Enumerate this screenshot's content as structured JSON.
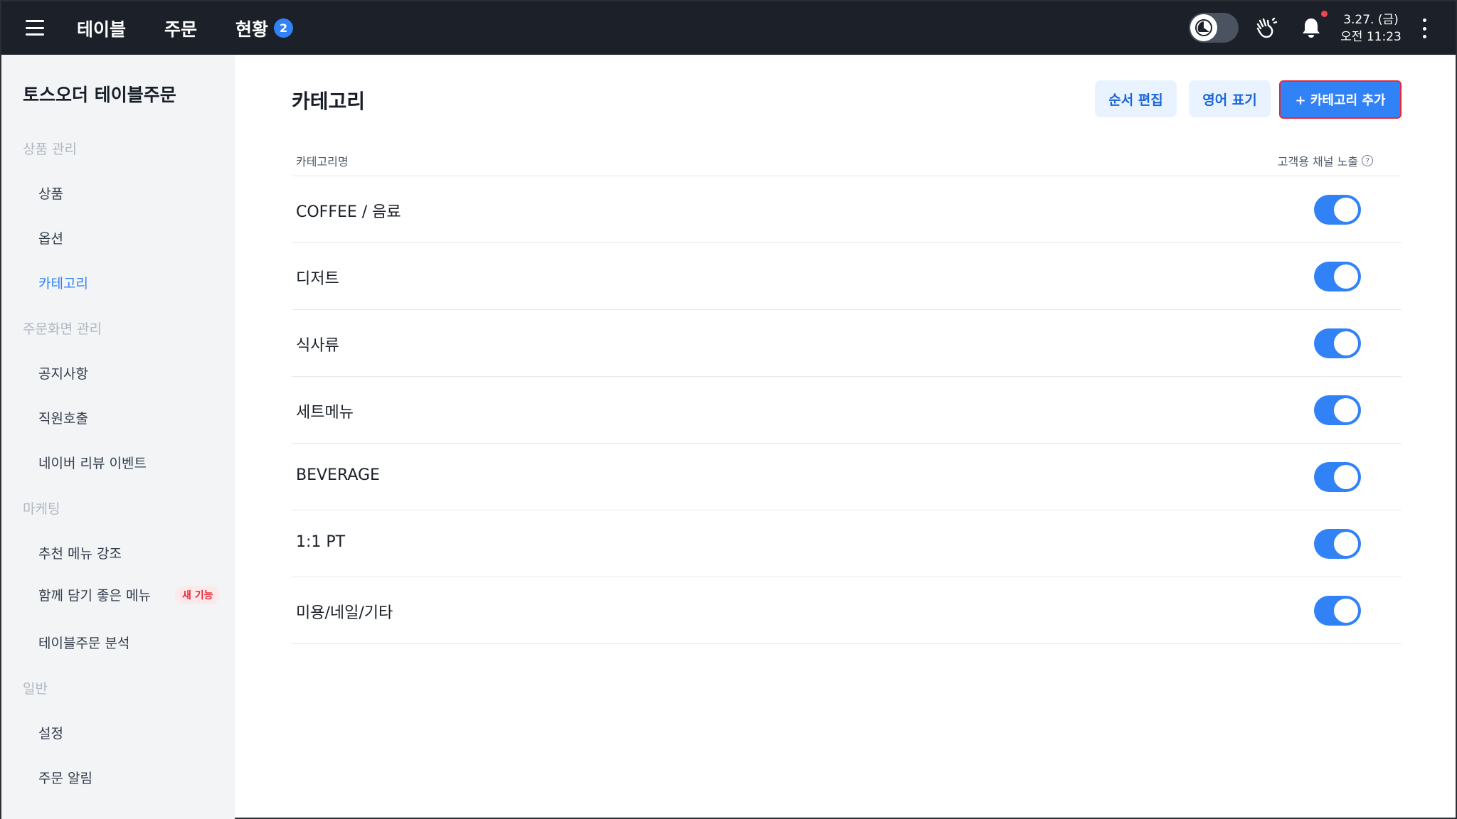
{
  "topbar": {
    "nav": [
      {
        "label": "테이블"
      },
      {
        "label": "주문"
      },
      {
        "label": "현황",
        "badge": "2"
      }
    ],
    "date": "3.27. (금)",
    "time": "오전 11:23"
  },
  "sidebar": {
    "brand": "토스오더 테이블주문",
    "sections": [
      {
        "title": "상품 관리",
        "items": [
          "상품",
          "옵션",
          "카테고리"
        ]
      },
      {
        "title": "주문화면 관리",
        "items": [
          "공지사항",
          "직원호출",
          "네이버 리뷰 이벤트"
        ]
      },
      {
        "title": "마케팅",
        "items": [
          "추천 메뉴 강조",
          "함께 담기 좋은 메뉴",
          "테이블주문 분석"
        ]
      },
      {
        "title": "일반",
        "items": [
          "설정",
          "주문 알림"
        ]
      }
    ],
    "new_badge": "새 기능",
    "active_item": "카테고리"
  },
  "main": {
    "title": "카테고리",
    "buttons": {
      "reorder": "순서 편집",
      "english": "영어 표기",
      "add": "+ 카테고리 추가"
    },
    "table": {
      "col_name": "카테고리명",
      "col_expose": "고객용 채널 노출",
      "rows": [
        {
          "name": "COFFEE / 음료",
          "exposed": true
        },
        {
          "name": "디저트",
          "exposed": true
        },
        {
          "name": "식사류",
          "exposed": true
        },
        {
          "name": "세트메뉴",
          "exposed": true
        },
        {
          "name": "BEVERAGE",
          "exposed": true
        },
        {
          "name": "1:1 PT",
          "exposed": true
        },
        {
          "name": "미용/네일/기타",
          "exposed": true
        }
      ]
    }
  },
  "colors": {
    "topbar_bg": "#1b2029",
    "accent": "#3182f6",
    "sidebar_bg": "#f2f4f6",
    "highlight_border": "#e42939"
  },
  "icons": [
    "menu-icon",
    "mode-toggle-icon",
    "hand-wave-icon",
    "bell-icon",
    "kebab-menu-icon",
    "help-circle-icon"
  ]
}
